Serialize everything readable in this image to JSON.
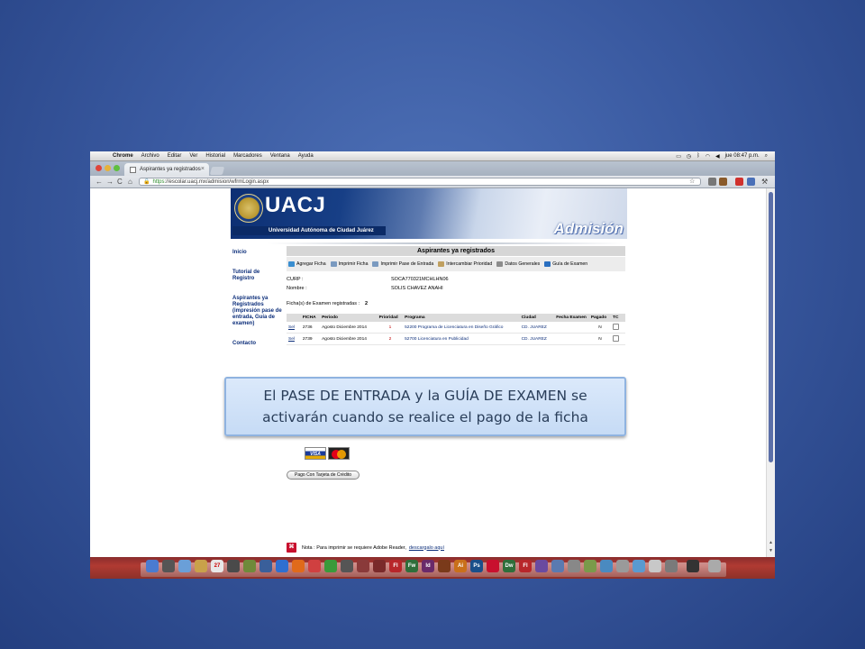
{
  "menubar": {
    "app": "Chrome",
    "items": [
      "Archivo",
      "Editar",
      "Ver",
      "Historial",
      "Marcadores",
      "Ventana",
      "Ayuda"
    ],
    "clock": "jue 08:47 p.m."
  },
  "browser": {
    "tab_title": "Aspirantes ya registrados",
    "url_scheme": "https",
    "url_rest": "://escolar.uacj.mx/admision/wfrmLogin.aspx"
  },
  "banner": {
    "logo_text": "UACJ",
    "university": "Universidad Autónoma de Ciudad Juárez",
    "section": "Admisión"
  },
  "sidenav": [
    "Inicio",
    "Tutorial de Registro",
    "Aspirantes ya Registrados (impresión pase de entrada, Guía de examen)",
    "Contacto"
  ],
  "main": {
    "title": "Aspirantes ya registrados",
    "actions": [
      "Agregar Ficha",
      "Imprimir Ficha",
      "Imprimir Pase de Entrada",
      "Intercambiar Prioridad",
      "Datos Generales",
      "Guía de Examen"
    ],
    "curp_label": "CURP :",
    "curp_value": "SOCA770321MCHLHN06",
    "nombre_label": "Nombre :",
    "nombre_value": "SOLIS CHAVEZ ANAHI",
    "count_label": "Ficha(s) de Examen registradas :",
    "count_value": "2",
    "table": {
      "headers": [
        "",
        "FICHA",
        "Periodo",
        "Prioridad",
        "Programa",
        "Ciudad",
        "Fecha Examen",
        "Pagado",
        "TC"
      ],
      "rows": [
        {
          "sel": "Sel",
          "ficha": "2736",
          "periodo": "Agosto Diciembre 2014",
          "prioridad": "1",
          "programa": "52200 Programa de Licenciatura en Diseño Gráfico",
          "ciudad": "CD. JUAREZ",
          "fecha": "",
          "pagado": "N"
        },
        {
          "sel": "Sel",
          "ficha": "2739",
          "periodo": "Agosto Diciembre 2014",
          "prioridad": "2",
          "programa": "52700 Licenciatura en Publicidad",
          "ciudad": "CD. JUAREZ",
          "fecha": "",
          "pagado": "N"
        }
      ]
    },
    "visa_label": "VISA",
    "pay_button": "Pago Con Tarjeta de Crédito",
    "note_text": "Nota : Para imprimir se requiere Adobe Reader,",
    "note_link": "descargalo aquí"
  },
  "callout": {
    "text": "El PASE DE ENTRADA y la GUÍA DE EXAMEN se activarán cuando se realice el pago de la ficha"
  },
  "colors": {
    "slide_bg": "#3a5aa1",
    "link": "#0c2e7a",
    "priority": "#c00000",
    "callout_bg": "#c6dbf5",
    "dock": "#b03a32"
  }
}
